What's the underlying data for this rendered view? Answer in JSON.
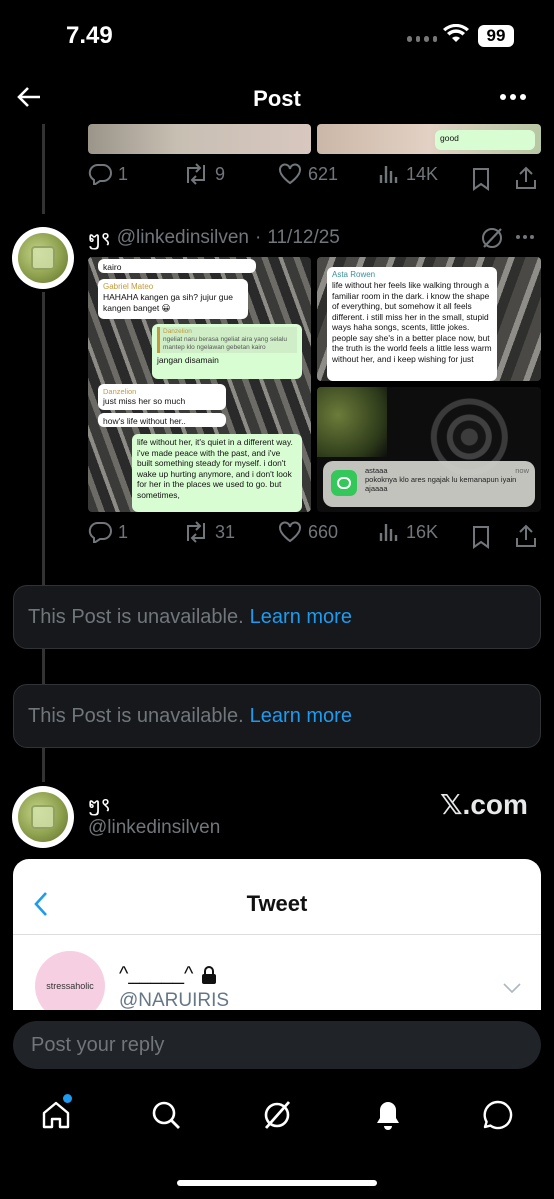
{
  "status_bar": {
    "time": "7.49",
    "battery": "99"
  },
  "header": {
    "title": "Post"
  },
  "post_above": {
    "bubble_text": "good",
    "stats": {
      "replies": "1",
      "reposts": "9",
      "likes": "621",
      "views": "14K"
    }
  },
  "post_main": {
    "display_name": "ໆ९",
    "handle": "@linkedinsilven",
    "date": "11/12/25",
    "image1": {
      "m1": "kairo",
      "m2_name": "Gabriel Mateo",
      "m2_text": "HAHAHA kangen ga sih? jujur gue kangen banget 😀",
      "m3_name": "Danzelion",
      "m3_text": "ngeliat naru berasa ngeliat aira yang selalu mantep klo ngelawan gebetan kairo",
      "m4": "jangan disamain",
      "m5_name": "Danzelion",
      "m5_text": "just miss her so much",
      "m6": "how's life without her..",
      "m7": "life without her, it's quiet in a different way. i've made peace with the past, and i've built something steady for myself. i don't wake up hurting anymore, and i don't look for her in the places we used to go. but sometimes,"
    },
    "image2": {
      "name": "Asta Rowen",
      "text": "life without her feels like walking through a familiar room in the dark. i know the shape of everything, but somehow it all feels different. i still miss her in the small, stupid ways haha songs, scents, little jokes. people say she's in a better place now, but the truth is the world feels a little less warm without her, and i keep wishing for just"
    },
    "image3": {
      "notif_title": "astaaa",
      "notif_time": "now",
      "notif_text": "pokoknya klo ares ngajak lu kemanapun iyain ajaaaa"
    },
    "stats": {
      "replies": "1",
      "reposts": "31",
      "likes": "660",
      "views": "16K"
    }
  },
  "unavailable": {
    "text": "This Post is unavailable.",
    "link": "Learn more"
  },
  "post_quote": {
    "display_name": "ໆ९",
    "handle": "@linkedinsilven",
    "watermark": "𝕏.com",
    "card": {
      "title": "Tweet",
      "avatar_text": "stressaholic",
      "name": "^_____^",
      "handle": "@NARUIRIS"
    }
  },
  "reply": {
    "placeholder": "Post your reply"
  },
  "colors": {
    "accent": "#1d9bf0",
    "background": "#000000",
    "muted": "#71767b"
  },
  "icons": [
    "back-arrow-icon",
    "more-icon",
    "reply-icon",
    "repost-icon",
    "like-icon",
    "views-icon",
    "bookmark-icon",
    "share-icon",
    "grok-icon",
    "home-icon",
    "search-icon",
    "notification-icon",
    "messages-icon"
  ]
}
